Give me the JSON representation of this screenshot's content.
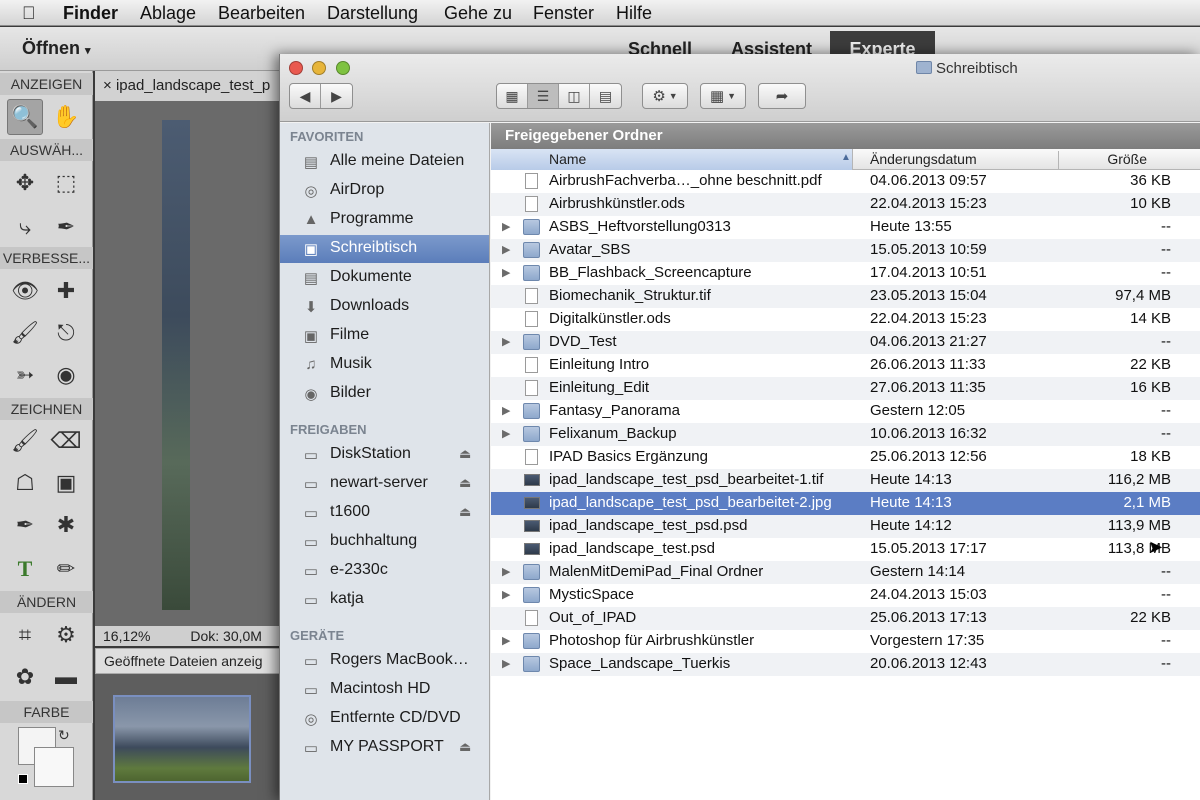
{
  "menubar": {
    "app": "Finder",
    "items": [
      "Ablage",
      "Bearbeiten",
      "Darstellung",
      "Gehe zu",
      "Fenster",
      "Hilfe"
    ]
  },
  "pse": {
    "open_label": "Öffnen",
    "modes": [
      "Schnell",
      "Assistent",
      "Experte"
    ],
    "active_mode": "Experte",
    "tool_sections": [
      "ANZEIGEN",
      "AUSWÄH...",
      "VERBESSE...",
      "ZEICHNEN",
      "ÄNDERN",
      "FARBE"
    ],
    "doc_tab": "ipad_landscape_test_p",
    "zoom": "16,12%",
    "doc_size": "Dok: 30,0M",
    "open_files_label": "Geöffnete Dateien anzeig"
  },
  "finder": {
    "window_title": "Schreibtisch",
    "path_header": "Freigegebener Ordner",
    "columns": {
      "name": "Name",
      "date": "Änderungsdatum",
      "size": "Größe"
    },
    "sidebar": {
      "favorites_head": "FAVORITEN",
      "favorites": [
        "Alle meine Dateien",
        "AirDrop",
        "Programme",
        "Schreibtisch",
        "Dokumente",
        "Downloads",
        "Filme",
        "Musik",
        "Bilder"
      ],
      "selected_favorite": "Schreibtisch",
      "shares_head": "FREIGABEN",
      "shares": [
        "DiskStation",
        "newart-server",
        "t1600",
        "buchhaltung",
        "e-2330c",
        "katja"
      ],
      "devices_head": "GERÄTE",
      "devices": [
        "Rogers MacBook…",
        "Macintosh HD",
        "Entfernte CD/DVD",
        "MY PASSPORT"
      ]
    },
    "files": [
      {
        "name": "AirbrushFachverba…_ohne beschnitt.pdf",
        "date": "04.06.2013 09:57",
        "size": "36 KB",
        "kind": "doc"
      },
      {
        "name": "Airbrushkünstler.ods",
        "date": "22.04.2013 15:23",
        "size": "10 KB",
        "kind": "doc"
      },
      {
        "name": "ASBS_Heftvorstellung0313",
        "date": "Heute 13:55",
        "size": "--",
        "kind": "folder"
      },
      {
        "name": "Avatar_SBS",
        "date": "15.05.2013 10:59",
        "size": "--",
        "kind": "folder"
      },
      {
        "name": "BB_Flashback_Screencapture",
        "date": "17.04.2013 10:51",
        "size": "--",
        "kind": "folder"
      },
      {
        "name": "Biomechanik_Struktur.tif",
        "date": "23.05.2013 15:04",
        "size": "97,4 MB",
        "kind": "doc"
      },
      {
        "name": "Digitalkünstler.ods",
        "date": "22.04.2013 15:23",
        "size": "14 KB",
        "kind": "doc"
      },
      {
        "name": "DVD_Test",
        "date": "04.06.2013 21:27",
        "size": "--",
        "kind": "folder"
      },
      {
        "name": "Einleitung Intro",
        "date": "26.06.2013 11:33",
        "size": "22 KB",
        "kind": "doc"
      },
      {
        "name": "Einleitung_Edit",
        "date": "27.06.2013 11:35",
        "size": "16 KB",
        "kind": "doc"
      },
      {
        "name": "Fantasy_Panorama",
        "date": "Gestern 12:05",
        "size": "--",
        "kind": "folder"
      },
      {
        "name": "Felixanum_Backup",
        "date": "10.06.2013 16:32",
        "size": "--",
        "kind": "folder"
      },
      {
        "name": "IPAD Basics Ergänzung",
        "date": "25.06.2013 12:56",
        "size": "18 KB",
        "kind": "doc"
      },
      {
        "name": "ipad_landscape_test_psd_bearbeitet-1.tif",
        "date": "Heute 14:13",
        "size": "116,2 MB",
        "kind": "img"
      },
      {
        "name": "ipad_landscape_test_psd_bearbeitet-2.jpg",
        "date": "Heute 14:13",
        "size": "2,1 MB",
        "kind": "img"
      },
      {
        "name": "ipad_landscape_test_psd.psd",
        "date": "Heute 14:12",
        "size": "113,9 MB",
        "kind": "img"
      },
      {
        "name": "ipad_landscape_test.psd",
        "date": "15.05.2013 17:17",
        "size": "113,8 MB",
        "kind": "img"
      },
      {
        "name": "MalenMitDemiPad_Final Ordner",
        "date": "Gestern 14:14",
        "size": "--",
        "kind": "folder"
      },
      {
        "name": "MysticSpace",
        "date": "24.04.2013 15:03",
        "size": "--",
        "kind": "folder"
      },
      {
        "name": "Out_of_IPAD",
        "date": "25.06.2013 17:13",
        "size": "22 KB",
        "kind": "doc"
      },
      {
        "name": "Photoshop für Airbrushkünstler",
        "date": "Vorgestern 17:35",
        "size": "--",
        "kind": "folder"
      },
      {
        "name": "Space_Landscape_Tuerkis",
        "date": "20.06.2013 12:43",
        "size": "--",
        "kind": "folder"
      }
    ],
    "selected_file": "ipad_landscape_test_psd_bearbeitet-2.jpg"
  },
  "colors": {
    "selection": "#5b7dc4",
    "sidebar_bg": "#dfe4ea",
    "expert_tab": "#3c3c3c"
  }
}
